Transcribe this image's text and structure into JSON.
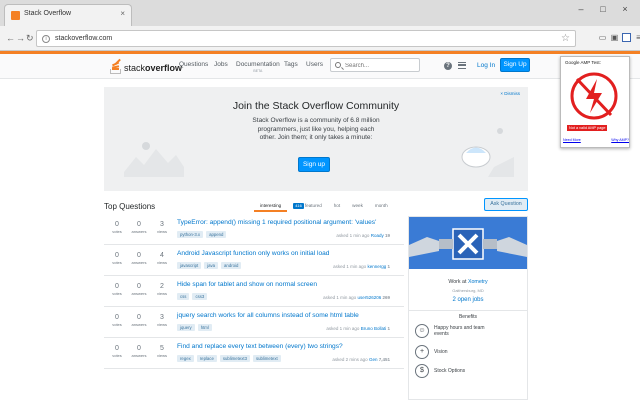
{
  "browser": {
    "tab_title": "Stack Overflow",
    "tab_close": "×",
    "url": "stackoverflow.com",
    "controls": [
      "–",
      "□",
      "×"
    ]
  },
  "header": {
    "logo_prefix": "stack",
    "logo_bold": "overflow",
    "nav": [
      {
        "label": "Questions"
      },
      {
        "label": "Jobs"
      },
      {
        "label": "Documentation",
        "sub": "BETA"
      },
      {
        "label": "Tags"
      },
      {
        "label": "Users"
      }
    ],
    "search_placeholder": "Search...",
    "help_glyph": "?",
    "login": "Log In",
    "signup": "Sign Up"
  },
  "hero": {
    "title": "Join the Stack Overflow Community",
    "text": "Stack Overflow is a community of 6.8 million programmers, just like you, helping each other. Join them; it only takes a minute:",
    "signup": "Sign up",
    "dismiss": "× Dismiss"
  },
  "questions_header": {
    "title": "Top Questions",
    "tabs": [
      "interesting",
      "featured",
      "hot",
      "week",
      "month"
    ],
    "featured_badge": "416",
    "ask": "Ask Question"
  },
  "questions": [
    {
      "votes": "0",
      "answers": "0",
      "views": "3",
      "title": "TypeError: append() missing 1 required positional argument: 'values'",
      "tags": [
        "python-3.x",
        "append"
      ],
      "asked": "asked 1 min ago",
      "user": "Roady",
      "rep": "19"
    },
    {
      "votes": "0",
      "answers": "0",
      "views": "4",
      "title": "Android Javascript function only works on initial load",
      "tags": [
        "javascript",
        "java",
        "android"
      ],
      "asked": "asked 1 min ago",
      "user": "kennergg",
      "rep": "1"
    },
    {
      "votes": "0",
      "answers": "0",
      "views": "2",
      "title": "Hide span for tablet and show on normal screen",
      "tags": [
        "css",
        "css3"
      ],
      "asked": "asked 1 min ago",
      "user": "user526206",
      "rep": "269"
    },
    {
      "votes": "0",
      "answers": "0",
      "views": "3",
      "title": "jquery search works for all columns instead of some html table",
      "tags": [
        "jquery",
        "html"
      ],
      "asked": "asked 1 min ago",
      "user": "Bruno Bollati",
      "rep": "1"
    },
    {
      "votes": "0",
      "answers": "0",
      "views": "5",
      "title": "Find and replace every text between (every) two strings?",
      "tags": [
        "regex",
        "replace",
        "sublimetext3",
        "sublimetext"
      ],
      "asked": "asked 2 mins ago",
      "user": "Gen",
      "rep": "7,451"
    }
  ],
  "labels": {
    "votes": "votes",
    "answers": "answers",
    "views": "views"
  },
  "job_ad": {
    "work_at": "Work at",
    "company": "Xometry",
    "location": "Gaithersburg, MD",
    "open_jobs": "2 open jobs",
    "benefits_title": "Benefits",
    "benefits": [
      {
        "icon": "smile-icon",
        "glyph": "☺",
        "text": "Happy hours and team events"
      },
      {
        "icon": "plus-icon",
        "glyph": "+",
        "text": "Vision"
      },
      {
        "icon": "dollar-icon",
        "glyph": "$",
        "text": "Stock Options"
      }
    ]
  },
  "amp_popup": {
    "title": "Google AMP Test:",
    "invalid": "Not a valid AMP page",
    "need_more": "Need More",
    "why_amp": "Why AMP?"
  },
  "colors": {
    "accent": "#f48024",
    "link": "#0077cc",
    "button": "#0095ff",
    "amp_red": "#e21f1f"
  }
}
